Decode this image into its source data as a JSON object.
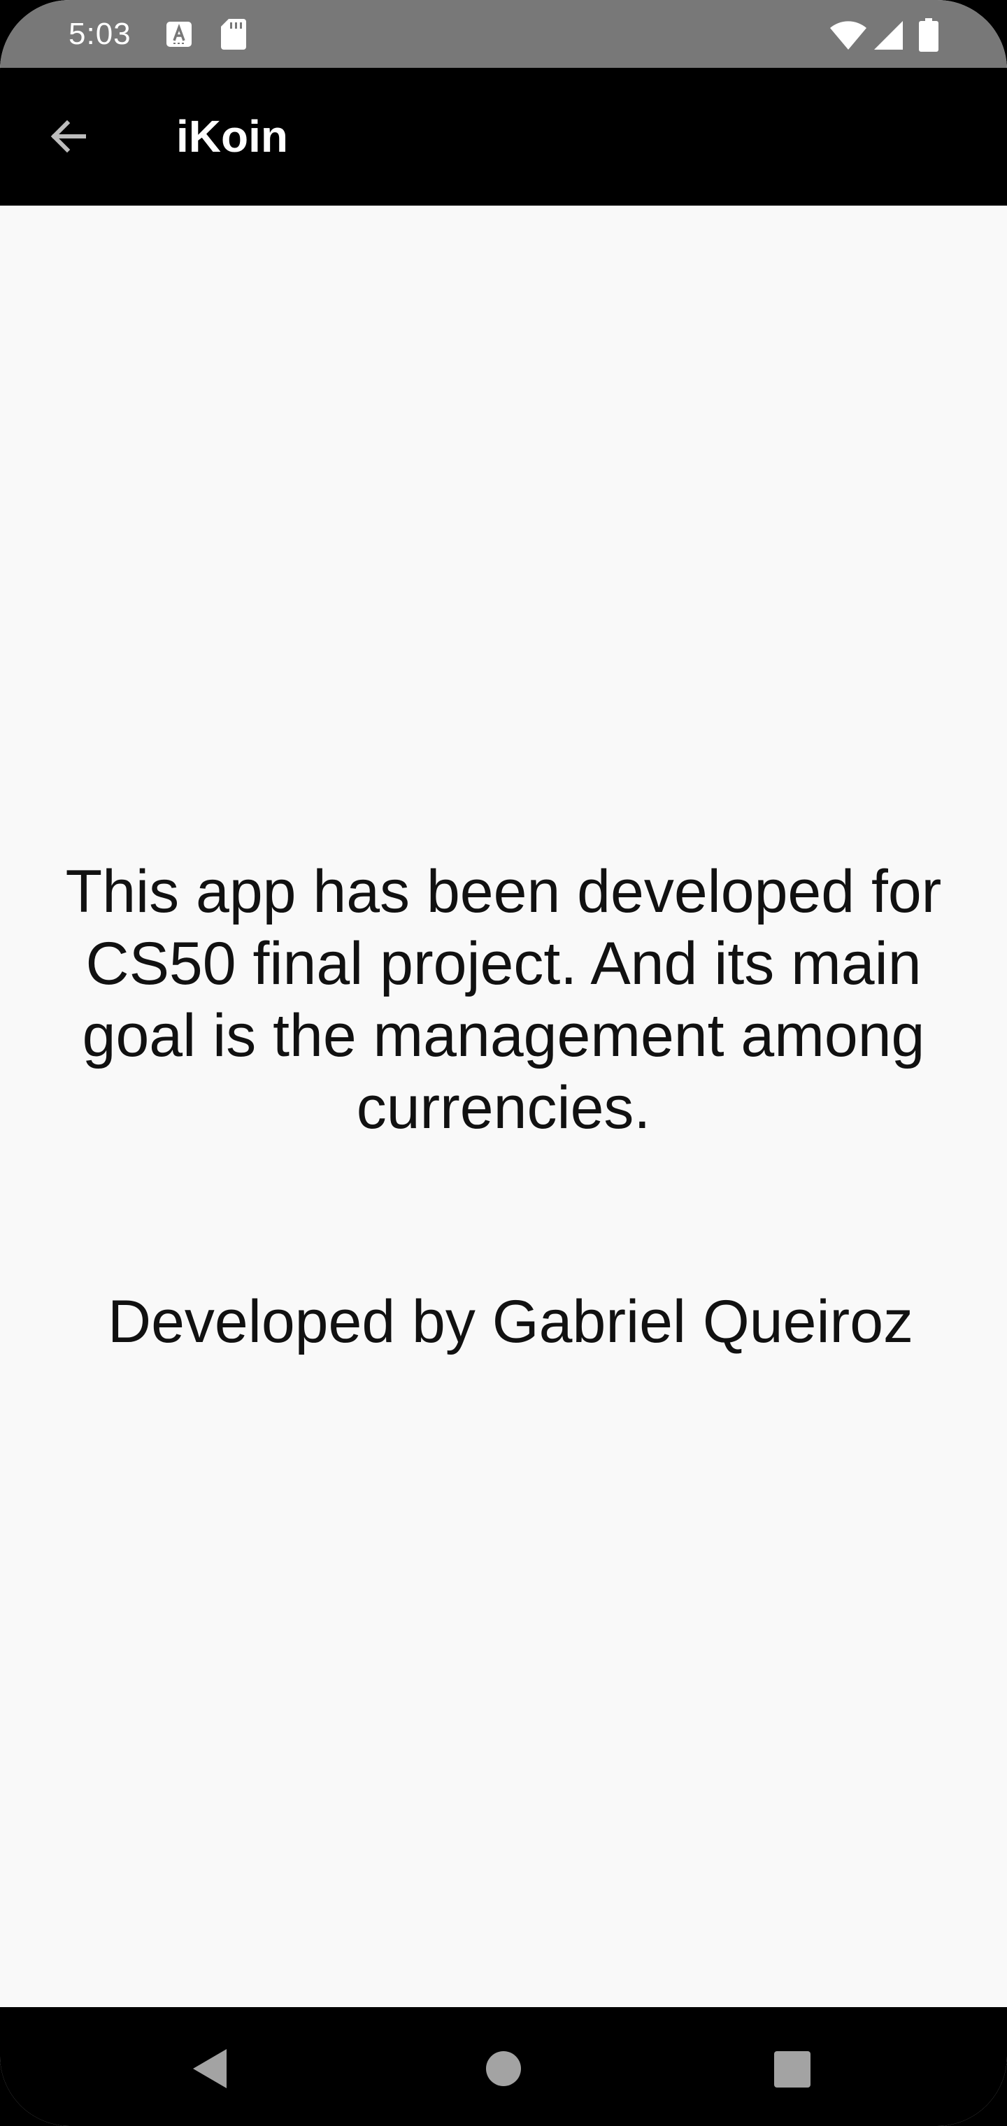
{
  "status_bar": {
    "time": "5:03",
    "icons": [
      "keyboard-a-icon",
      "sd-card-icon",
      "wifi-icon",
      "cell-signal-icon",
      "battery-icon"
    ]
  },
  "app_bar": {
    "back_icon": "arrow-back-icon",
    "title": "iKoin"
  },
  "main": {
    "description": "This app has been developed for CS50 final project. And its main goal is the management among currencies.",
    "developer": "Developed by Gabriel Queiroz"
  },
  "nav_bar": {
    "icons": [
      "nav-back-icon",
      "nav-home-icon",
      "nav-recents-icon"
    ]
  },
  "colors": {
    "status_bar": "#787878",
    "app_bar": "#000000",
    "background": "#F9F9F9",
    "text": "#111111"
  }
}
